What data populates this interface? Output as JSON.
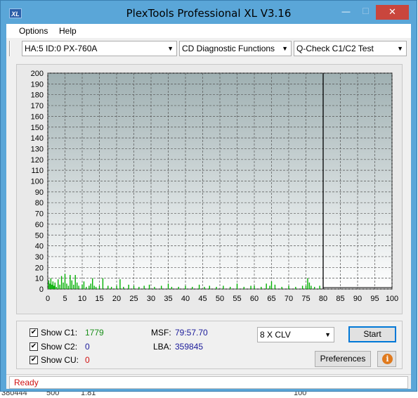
{
  "window": {
    "title": "PlexTools Professional XL V3.16",
    "icon_label": "XL",
    "controls": {
      "minimize": "—",
      "maximize": "☐",
      "close": "✕"
    }
  },
  "menu": {
    "options": "Options",
    "help": "Help"
  },
  "toolbar": {
    "drive": "HA:5 ID:0  PX-760A",
    "function": "CD Diagnostic Functions",
    "test": "Q-Check C1/C2 Test"
  },
  "chart_data": {
    "type": "bar",
    "title": "",
    "xlabel": "",
    "ylabel": "",
    "xlim": [
      0,
      100
    ],
    "ylim": [
      0,
      200
    ],
    "x_ticks": [
      0,
      5,
      10,
      15,
      20,
      25,
      30,
      35,
      40,
      45,
      50,
      55,
      60,
      65,
      70,
      75,
      80,
      85,
      90,
      95,
      100
    ],
    "y_ticks": [
      0,
      10,
      20,
      30,
      40,
      50,
      60,
      70,
      80,
      90,
      100,
      110,
      120,
      130,
      140,
      150,
      160,
      170,
      180,
      190,
      200
    ],
    "grid": true,
    "end_marker_x": 80,
    "series": [
      {
        "color": "#00b000",
        "x": [
          0.3,
          0.6,
          0.9,
          1.2,
          1.5,
          1.8,
          2.1,
          2.5,
          3.0,
          3.5,
          4.0,
          4.5,
          5.0,
          5.5,
          6.0,
          6.5,
          7.0,
          7.5,
          8.0,
          8.5,
          9.0,
          10.0,
          10.5,
          11.2,
          12.0,
          12.5,
          13.0,
          13.5,
          14.0,
          15.0,
          16.0,
          17.5,
          18.5,
          20.0,
          21.0,
          22.0,
          23.5,
          25.0,
          26.5,
          28.0,
          29.5,
          31.0,
          33.0,
          35.0,
          36.0,
          38.0,
          40.0,
          42.0,
          44.0,
          45.5,
          47.0,
          49.0,
          51.0,
          53.0,
          55.0,
          57.0,
          59.0,
          60.0,
          62.0,
          63.5,
          64.5,
          65.0,
          66.0,
          68.0,
          70.0,
          72.0,
          74.0,
          75.0,
          75.5,
          76.0,
          76.5,
          77.5,
          79.0
        ],
        "values": [
          8,
          5,
          10,
          4,
          7,
          3,
          6,
          2,
          9,
          4,
          12,
          6,
          14,
          5,
          3,
          13,
          8,
          4,
          13,
          6,
          3,
          4,
          7,
          2,
          3,
          5,
          10,
          3,
          2,
          3,
          10,
          3,
          2,
          3,
          9,
          2,
          4,
          3,
          2,
          3,
          4,
          2,
          3,
          5,
          2,
          2,
          3,
          2,
          4,
          2,
          3,
          2,
          3,
          2,
          5,
          2,
          3,
          3,
          2,
          5,
          3,
          7,
          4,
          2,
          3,
          2,
          3,
          3,
          10,
          6,
          3,
          2,
          3
        ]
      }
    ]
  },
  "stats": {
    "show_c1_label": "Show C1:",
    "c1_value": "1779",
    "show_c2_label": "Show C2:",
    "c2_value": "0",
    "show_cu_label": "Show CU:",
    "cu_value": "0",
    "msf_label": "MSF:",
    "msf_value": "79:57.70",
    "lba_label": "LBA:",
    "lba_value": "359845"
  },
  "controls": {
    "speed": "8 X CLV",
    "start_button": "Start",
    "preferences_button": "Preferences",
    "info_icon": "i"
  },
  "status": {
    "text": "Ready"
  },
  "background_strip": {
    "a": "380444",
    "b": "500",
    "c": "1.81",
    "d": "100"
  }
}
